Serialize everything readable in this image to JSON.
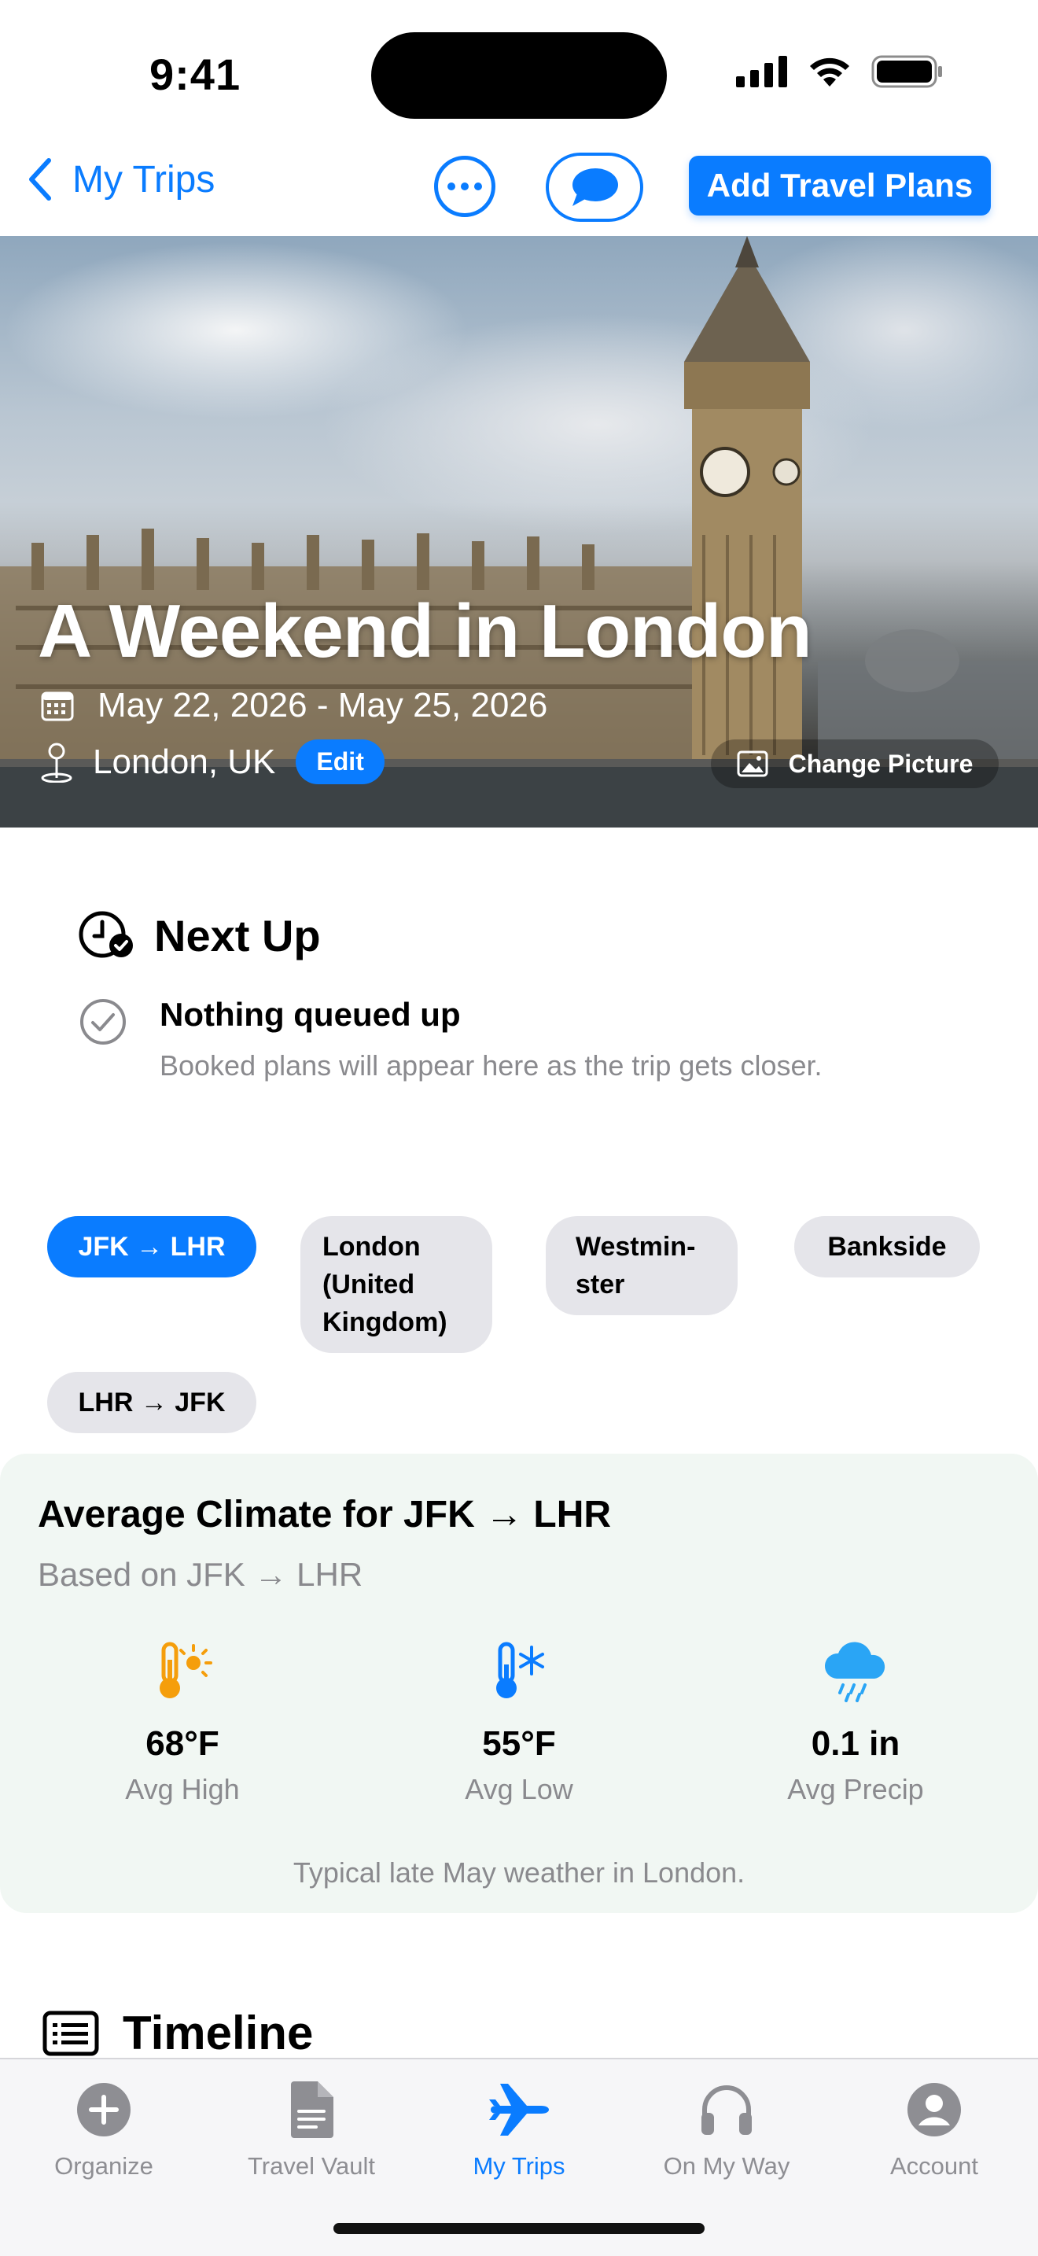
{
  "status_bar": {
    "time": "9:41"
  },
  "nav": {
    "back_label": "My Trips",
    "add_label": "Add Travel Plans"
  },
  "hero": {
    "title": "A Weekend in London",
    "dates": "May 22, 2026 - May 25, 2026",
    "location": "London, UK",
    "edit_label": "Edit",
    "change_picture_label": "Change Picture"
  },
  "next_up": {
    "title": "Next Up",
    "item_title": "Nothing queued up",
    "item_subtitle": "Booked plans will appear here as the trip gets closer."
  },
  "chips": [
    {
      "label": "JFK → LHR",
      "selected": true
    },
    {
      "label": "London (United Kingdom)",
      "selected": false
    },
    {
      "label": "Westmin-ster",
      "selected": false
    },
    {
      "label": "Bankside",
      "selected": false
    },
    {
      "label": "LHR → JFK",
      "selected": false
    }
  ],
  "climate": {
    "title": "Average Climate for JFK → LHR",
    "subtitle": "Based on JFK → LHR",
    "stats": [
      {
        "value": "68°F",
        "label": "Avg High",
        "icon": "hot-thermometer-icon",
        "color": "#f59e0b"
      },
      {
        "value": "55°F",
        "label": "Avg Low",
        "icon": "cold-thermometer-icon",
        "color": "#0a7cff"
      },
      {
        "value": "0.1 in",
        "label": "Avg Precip",
        "icon": "rain-cloud-icon",
        "color": "#2aa5f5"
      }
    ],
    "note": "Typical late May weather in London."
  },
  "timeline": {
    "title": "Timeline"
  },
  "tabbar": {
    "tabs": [
      {
        "label": "Organize",
        "icon": "plus-circle-icon",
        "active": false
      },
      {
        "label": "Travel Vault",
        "icon": "document-icon",
        "active": false
      },
      {
        "label": "My Trips",
        "icon": "airplane-icon",
        "active": true
      },
      {
        "label": "On My Way",
        "icon": "headphones-icon",
        "active": false
      },
      {
        "label": "Account",
        "icon": "person-circle-icon",
        "active": false
      }
    ]
  },
  "colors": {
    "accent": "#0a7cff",
    "chip_inactive": "#e5e5ea",
    "climate_bg": "#f1f7f3"
  }
}
